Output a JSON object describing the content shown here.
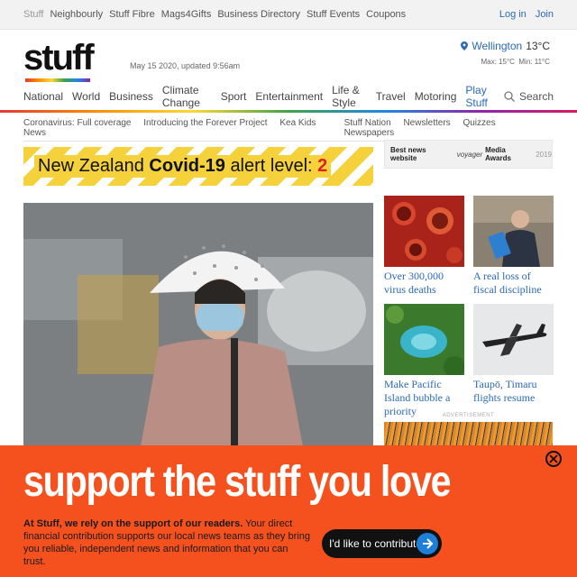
{
  "network_bar": {
    "links": [
      "Stuff",
      "Neighbourly",
      "Stuff Fibre",
      "Mags4Gifts",
      "Business Directory",
      "Stuff Events",
      "Coupons"
    ],
    "login": "Log in",
    "join": "Join"
  },
  "masthead": {
    "logo": "stuff",
    "dateline": "May 15 2020, updated 9:56am",
    "weather": {
      "location": "Wellington",
      "temp": "13°C",
      "max": "Max: 15°C",
      "min": "Min: 11°C"
    }
  },
  "section_nav": {
    "items": [
      "National",
      "World",
      "Business",
      "Climate Change",
      "Sport",
      "Entertainment",
      "Life & Style",
      "Travel",
      "Motoring",
      "Play Stuff"
    ],
    "search_label": "Search"
  },
  "sub_nav": {
    "left": [
      "Coronavirus: Full coverage",
      "Introducing the Forever Project",
      "Kea Kids News"
    ],
    "right": [
      "Stuff Nation",
      "Newsletters",
      "Quizzes",
      "Newspapers"
    ]
  },
  "covid_banner": {
    "prefix": "New Zealand",
    "bold": "Covid-19",
    "suffix": "alert level:",
    "level": "2"
  },
  "award": {
    "label": "Best news website",
    "sponsor": "voyager",
    "awards": "Media Awards",
    "year": "2019"
  },
  "tiles": [
    {
      "caption": "Over 300,000 virus deaths",
      "image": "virus-image"
    },
    {
      "caption": "A real loss of fiscal discipline",
      "image": "politician-image"
    },
    {
      "caption": "Make Pacific Island bubble a priority",
      "image": "lagoon-image"
    },
    {
      "caption": "Taupō, Timaru flights resume",
      "image": "plane-image"
    }
  ],
  "ad_label": "ADVERTISEMENT",
  "support_overlay": {
    "headline": "support the stuff you love",
    "body_bold": "At Stuff, we rely on the support of our readers.",
    "body_rest": " Your direct financial contribution supports our local news teams as they bring you reliable, independent news and information that you can trust.",
    "cta": "I'd like to contribute"
  },
  "colors": {
    "link_blue": "#2a6ab8",
    "overlay_orange": "#f4511e",
    "covid_yellow": "#f5d23c",
    "alert_red": "#e02020"
  }
}
